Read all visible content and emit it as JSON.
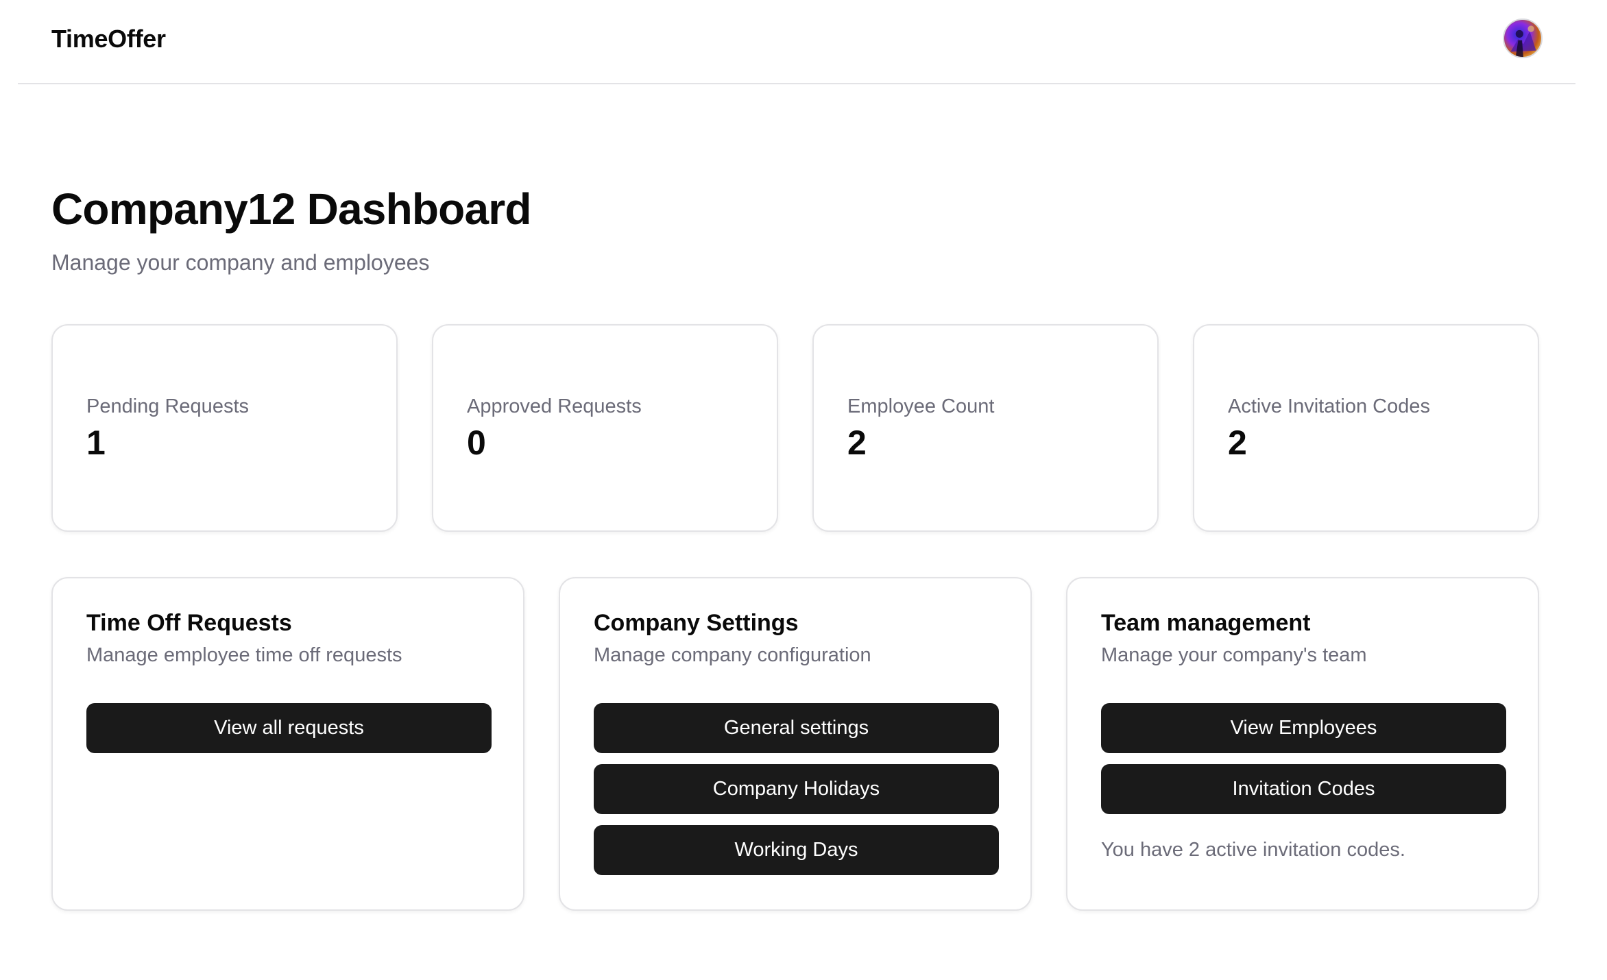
{
  "header": {
    "brand": "TimeOffer",
    "avatar_icon": "user-avatar-icon"
  },
  "page": {
    "title": "Company12 Dashboard",
    "subtitle": "Manage your company and employees"
  },
  "stats": [
    {
      "label": "Pending Requests",
      "value": "1"
    },
    {
      "label": "Approved Requests",
      "value": "0"
    },
    {
      "label": "Employee Count",
      "value": "2"
    },
    {
      "label": "Active Invitation Codes",
      "value": "2"
    }
  ],
  "panels": {
    "time_off": {
      "title": "Time Off Requests",
      "description": "Manage employee time off requests",
      "buttons": [
        "View all requests"
      ]
    },
    "company_settings": {
      "title": "Company Settings",
      "description": "Manage company configuration",
      "buttons": [
        "General settings",
        "Company Holidays",
        "Working Days"
      ]
    },
    "team": {
      "title": "Team management",
      "description": "Manage your company's team",
      "buttons": [
        "View Employees",
        "Invitation Codes"
      ],
      "note": "You have 2 active invitation codes."
    }
  },
  "colors": {
    "button_bg": "#1a1a1a",
    "muted_text": "#6b6b78",
    "border": "#e3e3e6"
  }
}
